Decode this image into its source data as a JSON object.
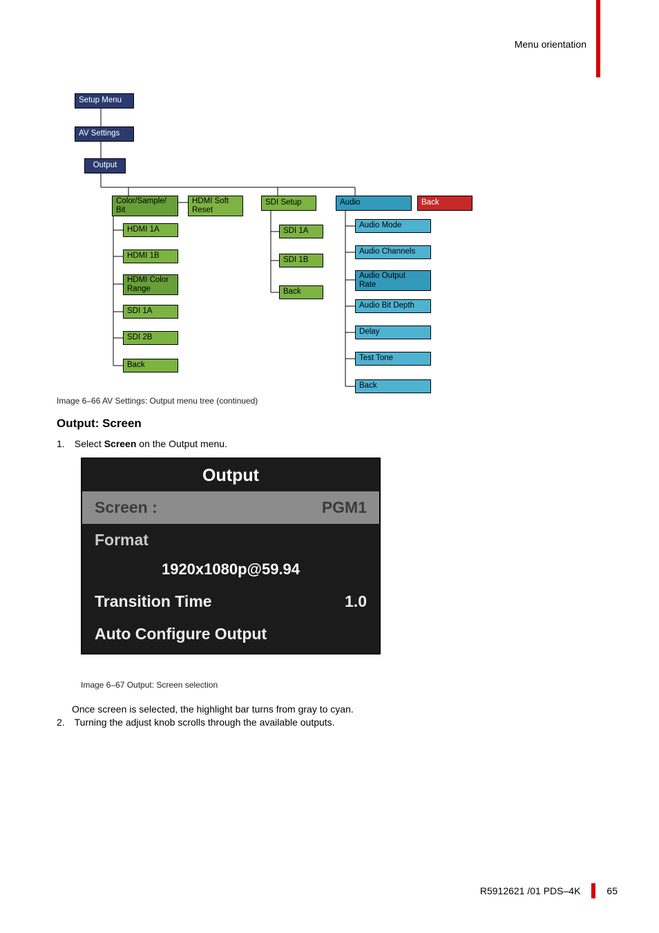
{
  "header": {
    "section": "Menu orientation"
  },
  "tree": {
    "setup": "Setup Menu",
    "av": "AV Settings",
    "output": "Output",
    "col1": {
      "top": "Color/Sample/\nBit",
      "hdmi_soft": "HDMI Soft\nReset",
      "h1a": "HDMI 1A",
      "h1b": "HDMI 1B",
      "hcol": "HDMI Color\nRange",
      "s1a": "SDI 1A",
      "s2b": "SDI 2B",
      "back": "Back"
    },
    "col2": {
      "top": "SDI Setup",
      "s1a": "SDI 1A",
      "s1b": "SDI 1B",
      "back": "Back"
    },
    "col3": {
      "top": "Audio",
      "back_btn": "Back",
      "mode": "Audio Mode",
      "chan": "Audio Channels",
      "rate": "Audio Output\nRate",
      "depth": "Audio Bit Depth",
      "delay": "Delay",
      "tone": "Test Tone",
      "back": "Back"
    }
  },
  "caption1": "Image 6–66  AV Settings: Output menu tree (continued)",
  "heading": "Output: Screen",
  "step1_num": "1.",
  "step1_a": "Select ",
  "step1_b": "Screen",
  "step1_c": " on the Output menu.",
  "output_menu": {
    "title": "Output",
    "screen_label": "Screen :",
    "screen_value": "PGM1",
    "format_label": "Format",
    "format_value": "1920x1080p@59.94",
    "trans_label": "Transition Time",
    "trans_value": "1.0",
    "acfg_label": "Auto Configure Output"
  },
  "caption2": "Image 6–67  Output: Screen selection",
  "intro": "Once screen is selected, the highlight bar turns from gray to cyan.",
  "step2_num": "2.",
  "step2": "Turning the adjust knob scrolls through the available outputs.",
  "footer": {
    "doc": "R5912621 /01 PDS–4K",
    "page": "65"
  }
}
